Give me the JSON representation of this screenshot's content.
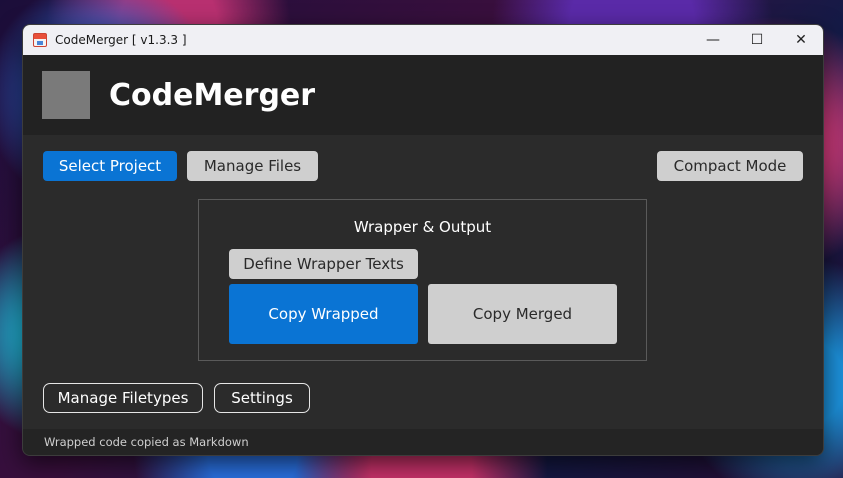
{
  "window": {
    "title": "CodeMerger [ v1.3.3 ]",
    "controls": {
      "minimize": "—",
      "maximize": "☐",
      "close": "✕"
    }
  },
  "header": {
    "app_name": "CodeMerger"
  },
  "toolbar": {
    "select_project": "Select Project",
    "manage_files": "Manage Files",
    "compact_mode": "Compact Mode"
  },
  "wrapper_panel": {
    "title": "Wrapper & Output",
    "define_wrapper": "Define Wrapper Texts",
    "copy_wrapped": "Copy Wrapped",
    "copy_merged": "Copy Merged"
  },
  "bottom": {
    "manage_filetypes": "Manage Filetypes",
    "settings": "Settings"
  },
  "status": {
    "message": "Wrapped code copied as Markdown"
  },
  "colors": {
    "accent": "#0a74d4",
    "background": "#2b2b2b",
    "header": "#222222"
  }
}
